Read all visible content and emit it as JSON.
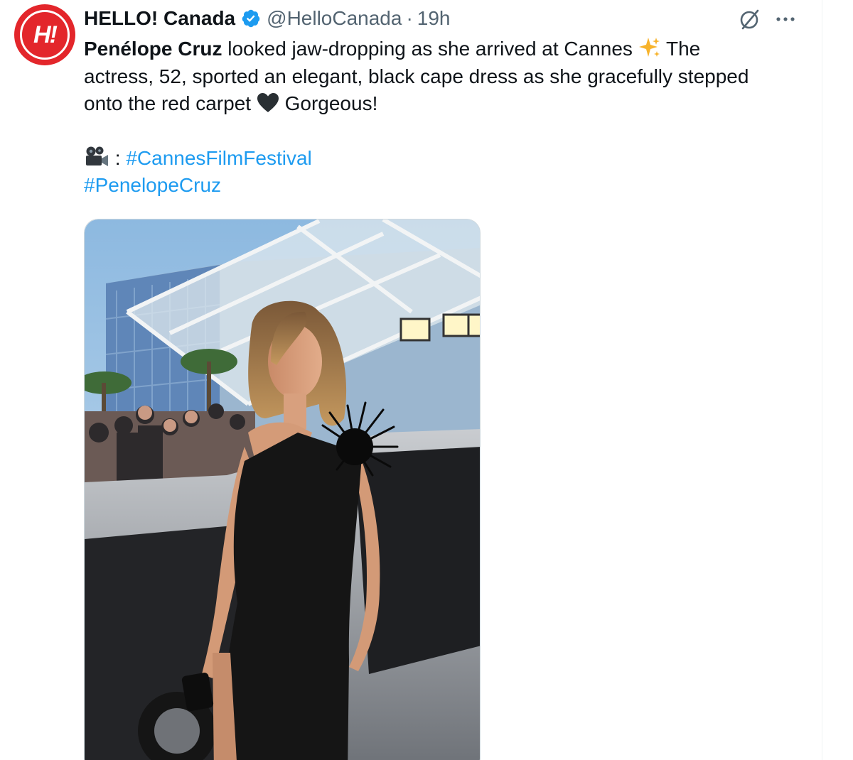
{
  "tweet": {
    "author": {
      "avatar_text": "H!",
      "display_name": "HELLO! Canada",
      "verified": true,
      "handle": "@HelloCanada",
      "separator": "·",
      "time": "19h"
    },
    "text": {
      "bold_name": "Penélope Cruz",
      "line1_rest": " looked jaw-dropping as she arrived at Cannes ",
      "line1_after_emoji": " The",
      "line2": "actress, 52, sported an elegant, black cape dress as she gracefully stepped",
      "line3_start": "onto the red carpet ",
      "line3_end": " Gorgeous!",
      "camera_colon": " : ",
      "hashtag1": "#CannesFilmFestival",
      "hashtag2": "#PenelopeCruz"
    },
    "icons": [
      "verified-badge-icon",
      "grok-icon",
      "more-icon",
      "sparkles-emoji",
      "black-heart-emoji",
      "movie-camera-emoji"
    ],
    "colors": {
      "accent": "#1d9bf0",
      "text": "#0f1419",
      "secondary": "#536471",
      "avatar_bg": "#e3262b"
    }
  }
}
